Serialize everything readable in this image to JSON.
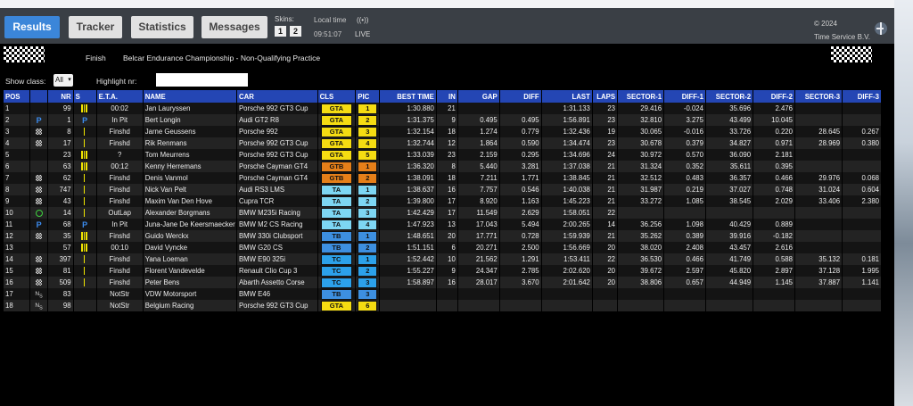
{
  "tabs": [
    {
      "label": "Results"
    },
    {
      "label": "Tracker"
    },
    {
      "label": "Statistics"
    },
    {
      "label": "Messages"
    }
  ],
  "skins": {
    "label": "Skins:",
    "options": [
      "1",
      "2"
    ]
  },
  "local_time": {
    "label": "Local time",
    "value": "09:51:07"
  },
  "live": {
    "icon": "((•))",
    "label": "LIVE"
  },
  "copyright": {
    "year": "© 2024",
    "company": "Time Service B.V."
  },
  "subheader": {
    "status": "Finish",
    "event": "Belcar Endurance Championship - Non-Qualifying Practice"
  },
  "filters": {
    "show_class_label": "Show class:",
    "show_class_value": "All",
    "highlight_label": "Highlight nr:",
    "highlight_value": ""
  },
  "columns": [
    "POS",
    "",
    "NR",
    "S",
    "E.T.A.",
    "NAME",
    "CAR",
    "CLS",
    "PIC",
    "BEST TIME",
    "IN",
    "GAP",
    "DIFF",
    "LAST",
    "LAPS",
    "SECTOR-1",
    "DIFF-1",
    "SECTOR-2",
    "DIFF-2",
    "SECTOR-3",
    "DIFF-3"
  ],
  "colors": {
    "header_blue": "#2446b4",
    "GTA": "#f5dc12",
    "GTB": "#e57f19",
    "TA": "#7dd6f3",
    "TB": "#3d8fe0",
    "TC": "#2ca1ea",
    "purple": "#e04ce9",
    "green": "#3de33d"
  },
  "rows": [
    {
      "pos": "1",
      "icon": "",
      "nr": "99",
      "s": "3",
      "eta": "00:02",
      "name": "Jan Lauryssen",
      "car": "Porsche 992 GT3 Cup",
      "cls": "GTA",
      "pic": "1",
      "best": "1:30.880",
      "in": "21",
      "gap": "",
      "diff": "",
      "last": "1:31.133",
      "laps": "23",
      "s1": "29.416",
      "d1": "-0.024",
      "s2": "35.696",
      "d2": "2.476",
      "s3": "",
      "d3": "",
      "s1_color": "purple"
    },
    {
      "pos": "2",
      "icon": "P",
      "nr": "1",
      "s": "P",
      "eta": "In Pit",
      "name": "Bert Longin",
      "car": "Audi GT2 R8",
      "cls": "GTA",
      "pic": "2",
      "best": "1:31.375",
      "in": "9",
      "gap": "0.495",
      "diff": "0.495",
      "last": "1:56.891",
      "laps": "23",
      "s1": "32.810",
      "d1": "3.275",
      "s2": "43.499",
      "d2": "10.045",
      "s3": "",
      "d3": ""
    },
    {
      "pos": "3",
      "icon": "flag",
      "nr": "8",
      "s": "1",
      "eta": "Finshd",
      "name": "Jarne Geussens",
      "car": "Porsche 992",
      "cls": "GTA",
      "pic": "3",
      "best": "1:32.154",
      "in": "18",
      "gap": "1.274",
      "diff": "0.779",
      "last": "1:32.436",
      "laps": "19",
      "s1": "30.065",
      "d1": "-0.016",
      "s2": "33.726",
      "d2": "0.220",
      "s3": "28.645",
      "d3": "0.267",
      "s1_color": "green"
    },
    {
      "pos": "4",
      "icon": "flag",
      "nr": "17",
      "s": "1",
      "eta": "Finshd",
      "name": "Rik Renmans",
      "car": "Porsche 992 GT3 Cup",
      "cls": "GTA",
      "pic": "4",
      "best": "1:32.744",
      "in": "12",
      "gap": "1.864",
      "diff": "0.590",
      "last": "1:34.474",
      "laps": "23",
      "s1": "30.678",
      "d1": "0.379",
      "s2": "34.827",
      "d2": "0.971",
      "s3": "28.969",
      "d3": "0.380"
    },
    {
      "pos": "5",
      "icon": "",
      "nr": "23",
      "s": "3",
      "eta": "?",
      "name": "Tom Meurrens",
      "car": "Porsche 992 GT3 Cup",
      "cls": "GTA",
      "pic": "5",
      "best": "1:33.039",
      "in": "23",
      "gap": "2.159",
      "diff": "0.295",
      "last": "1:34.696",
      "laps": "24",
      "s1": "30.972",
      "d1": "0.570",
      "s2": "36.090",
      "d2": "2.181",
      "s3": "",
      "d3": ""
    },
    {
      "pos": "6",
      "icon": "",
      "nr": "63",
      "s": "3",
      "eta": "00:12",
      "name": "Kenny Herremans",
      "car": "Porsche Cayman GT4",
      "cls": "GTB",
      "pic": "1",
      "best": "1:36.320",
      "in": "8",
      "gap": "5.440",
      "diff": "3.281",
      "last": "1:37.038",
      "laps": "21",
      "s1": "31.324",
      "d1": "0.352",
      "s2": "35.611",
      "d2": "0.395",
      "s3": "",
      "d3": ""
    },
    {
      "pos": "7",
      "icon": "flag",
      "nr": "62",
      "s": "1",
      "eta": "Finshd",
      "name": "Denis Vanmol",
      "car": "Porsche Cayman GT4",
      "cls": "GTB",
      "pic": "2",
      "best": "1:38.091",
      "in": "18",
      "gap": "7.211",
      "diff": "1.771",
      "last": "1:38.845",
      "laps": "21",
      "s1": "32.512",
      "d1": "0.483",
      "s2": "36.357",
      "d2": "0.466",
      "s3": "29.976",
      "d3": "0.068"
    },
    {
      "pos": "8",
      "icon": "flag",
      "nr": "747",
      "s": "1",
      "eta": "Finshd",
      "name": "Nick Van Pelt",
      "car": "Audi RS3 LMS",
      "cls": "TA",
      "pic": "1",
      "best": "1:38.637",
      "in": "16",
      "gap": "7.757",
      "diff": "0.546",
      "last": "1:40.038",
      "laps": "21",
      "s1": "31.987",
      "d1": "0.219",
      "s2": "37.027",
      "d2": "0.748",
      "s3": "31.024",
      "d3": "0.604"
    },
    {
      "pos": "9",
      "icon": "flag",
      "nr": "43",
      "s": "1",
      "eta": "Finshd",
      "name": "Maxim Van Den Hove",
      "car": "Cupra TCR",
      "cls": "TA",
      "pic": "2",
      "best": "1:39.800",
      "in": "17",
      "gap": "8.920",
      "diff": "1.163",
      "last": "1:45.223",
      "laps": "21",
      "s1": "33.272",
      "d1": "1.085",
      "s2": "38.545",
      "d2": "2.029",
      "s3": "33.406",
      "d3": "2.380"
    },
    {
      "pos": "10",
      "icon": "O",
      "nr": "14",
      "s": "1",
      "eta": "OutLap",
      "name": "Alexander Borgmans",
      "car": "BMW M235i Racing",
      "cls": "TA",
      "pic": "3",
      "best": "1:42.429",
      "in": "17",
      "gap": "11.549",
      "diff": "2.629",
      "last": "1:58.051",
      "laps": "22",
      "s1": "",
      "d1": "",
      "s2": "",
      "d2": "",
      "s3": "",
      "d3": ""
    },
    {
      "pos": "11",
      "icon": "P",
      "nr": "68",
      "s": "P",
      "eta": "In Pit",
      "name": "Juna-Jane De Keersmaecker",
      "car": "BMW M2 CS Racing",
      "cls": "TA",
      "pic": "4",
      "best": "1:47.923",
      "in": "13",
      "gap": "17.043",
      "diff": "5.494",
      "last": "2:00.265",
      "laps": "14",
      "s1": "36.256",
      "d1": "1.098",
      "s2": "40.429",
      "d2": "0.889",
      "s3": "",
      "d3": ""
    },
    {
      "pos": "12",
      "icon": "flag",
      "nr": "35",
      "s": "3",
      "eta": "Finshd",
      "name": "Guido Werckx",
      "car": "BMW 330i Clubsport",
      "cls": "TB",
      "pic": "1",
      "best": "1:48.651",
      "in": "20",
      "gap": "17.771",
      "diff": "0.728",
      "last": "1:59.939",
      "laps": "21",
      "s1": "35.262",
      "d1": "0.389",
      "s2": "39.916",
      "d2": "-0.182",
      "s3": "",
      "d3": "",
      "s2_color": "green"
    },
    {
      "pos": "13",
      "icon": "",
      "nr": "57",
      "s": "3",
      "eta": "00:10",
      "name": "David Vyncke",
      "car": "BMW G20 CS",
      "cls": "TB",
      "pic": "2",
      "best": "1:51.151",
      "in": "6",
      "gap": "20.271",
      "diff": "2.500",
      "last": "1:56.669",
      "laps": "20",
      "s1": "38.020",
      "d1": "2.408",
      "s2": "43.457",
      "d2": "2.616",
      "s3": "",
      "d3": ""
    },
    {
      "pos": "14",
      "icon": "flag",
      "nr": "397",
      "s": "1",
      "eta": "Finshd",
      "name": "Yana Loeman",
      "car": "BMW E90 325i",
      "cls": "TC",
      "pic": "1",
      "best": "1:52.442",
      "in": "10",
      "gap": "21.562",
      "diff": "1.291",
      "last": "1:53.411",
      "laps": "22",
      "s1": "36.530",
      "d1": "0.466",
      "s2": "41.749",
      "d2": "0.588",
      "s3": "35.132",
      "d3": "0.181"
    },
    {
      "pos": "15",
      "icon": "flag",
      "nr": "81",
      "s": "1",
      "eta": "Finshd",
      "name": "Florent Vandevelde",
      "car": "Renault Clio Cup 3",
      "cls": "TC",
      "pic": "2",
      "best": "1:55.227",
      "in": "9",
      "gap": "24.347",
      "diff": "2.785",
      "last": "2:02.620",
      "laps": "20",
      "s1": "39.672",
      "d1": "2.597",
      "s2": "45.820",
      "d2": "2.897",
      "s3": "37.128",
      "d3": "1.995"
    },
    {
      "pos": "16",
      "icon": "flag",
      "nr": "509",
      "s": "1",
      "eta": "Finshd",
      "name": "Peter Bens",
      "car": "Abarth Assetto Corse",
      "cls": "TC",
      "pic": "3",
      "best": "1:58.897",
      "in": "16",
      "gap": "28.017",
      "diff": "3.670",
      "last": "2:01.642",
      "laps": "20",
      "s1": "38.806",
      "d1": "0.657",
      "s2": "44.949",
      "d2": "1.145",
      "s3": "37.887",
      "d3": "1.141"
    },
    {
      "pos": "17",
      "icon": "NS",
      "nr": "83",
      "s": "",
      "eta": "NotStr",
      "name": "VDW Motorsport",
      "car": "BMW E46",
      "cls": "TB",
      "pic": "3",
      "best": "",
      "in": "",
      "gap": "",
      "diff": "",
      "last": "",
      "laps": "",
      "s1": "",
      "d1": "",
      "s2": "",
      "d2": "",
      "s3": "",
      "d3": ""
    },
    {
      "pos": "18",
      "icon": "NS",
      "nr": "98",
      "s": "",
      "eta": "NotStr",
      "name": "Belgium Racing",
      "car": "Porsche 992 GT3 Cup",
      "cls": "GTA",
      "pic": "6",
      "best": "",
      "in": "",
      "gap": "",
      "diff": "",
      "last": "",
      "laps": "",
      "s1": "",
      "d1": "",
      "s2": "",
      "d2": "",
      "s3": "",
      "d3": ""
    }
  ]
}
